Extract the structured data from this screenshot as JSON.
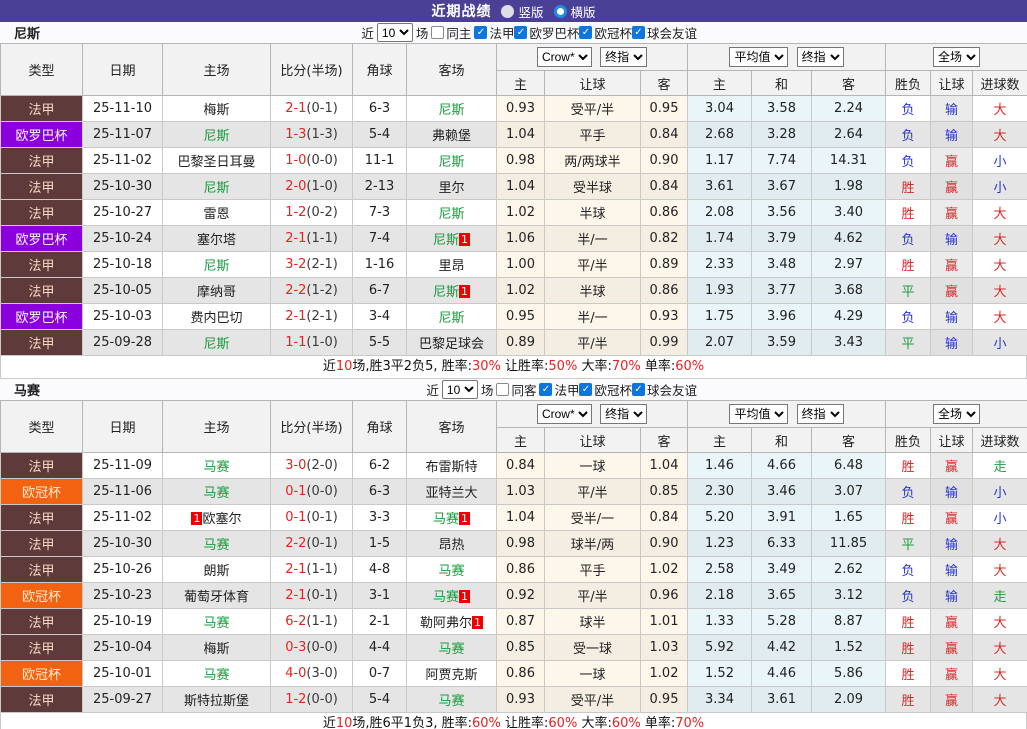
{
  "title_bar": {
    "title": "近期战绩",
    "vertical_label": "竖版",
    "horizontal_label": "横版"
  },
  "league_styles": {
    "法甲": {
      "bg": "#5E3A3A",
      "fg": "#F5DBC4"
    },
    "欧罗巴杯": {
      "bg": "#8A00DD",
      "fg": "#FFFFFF"
    },
    "欧冠杯": {
      "bg": "#F26211",
      "fg": "#FFF0D2"
    }
  },
  "result_colors": {
    "胜": "#D42A2A",
    "负": "#2635CE",
    "平": "#1E9E3E",
    "赢": "#D42A2A",
    "输": "#2635CE",
    "走": "#1E9E3E",
    "大": "#D42A2A",
    "小": "#2635CE"
  },
  "sections": [
    {
      "team": "尼斯",
      "filter": {
        "near_label": "近",
        "games_count": "10",
        "games_label": "场",
        "same_label": "同主",
        "leagues": [
          "法甲",
          "欧罗巴杯",
          "欧冠杯",
          "球会友谊"
        ]
      },
      "header": {
        "cols": [
          "类型",
          "日期",
          "主场",
          "比分(半场)",
          "角球",
          "客场"
        ],
        "dropdowns": [
          "Crow*",
          "终指",
          "平均值",
          "终指",
          "全场"
        ],
        "sub": [
          "主",
          "让球",
          "客",
          "主",
          "和",
          "客",
          "胜负",
          "让球",
          "进球数"
        ]
      },
      "rows": [
        {
          "lg": "法甲",
          "dt": "25-11-10",
          "hm": "梅斯",
          "hf": 0,
          "hc": 0,
          "sc": "2-1",
          "ht": "(0-1)",
          "cn": "6-3",
          "aw": "尼斯",
          "af": 1,
          "ac": 0,
          "o1": "0.93",
          "hd": "受平/半",
          "o2": "0.95",
          "ah": "3.04",
          "ad": "3.58",
          "aa": "2.24",
          "r1": "负",
          "r2": "输",
          "r3": "大"
        },
        {
          "lg": "欧罗巴杯",
          "dt": "25-11-07",
          "hm": "尼斯",
          "hf": 1,
          "hc": 0,
          "sc": "1-3",
          "ht": "(1-3)",
          "cn": "5-4",
          "aw": "弗赖堡",
          "af": 0,
          "ac": 0,
          "o1": "1.04",
          "hd": "平手",
          "o2": "0.84",
          "ah": "2.68",
          "ad": "3.28",
          "aa": "2.64",
          "r1": "负",
          "r2": "输",
          "r3": "大"
        },
        {
          "lg": "法甲",
          "dt": "25-11-02",
          "hm": "巴黎圣日耳曼",
          "hf": 0,
          "hc": 0,
          "sc": "1-0",
          "ht": "(0-0)",
          "cn": "11-1",
          "aw": "尼斯",
          "af": 1,
          "ac": 0,
          "o1": "0.98",
          "hd": "两/两球半",
          "o2": "0.90",
          "ah": "1.17",
          "ad": "7.74",
          "aa": "14.31",
          "r1": "负",
          "r2": "赢",
          "r3": "小"
        },
        {
          "lg": "法甲",
          "dt": "25-10-30",
          "hm": "尼斯",
          "hf": 1,
          "hc": 0,
          "sc": "2-0",
          "ht": "(1-0)",
          "cn": "2-13",
          "aw": "里尔",
          "af": 0,
          "ac": 0,
          "o1": "1.04",
          "hd": "受半球",
          "o2": "0.84",
          "ah": "3.61",
          "ad": "3.67",
          "aa": "1.98",
          "r1": "胜",
          "r2": "赢",
          "r3": "小"
        },
        {
          "lg": "法甲",
          "dt": "25-10-27",
          "hm": "雷恩",
          "hf": 0,
          "hc": 0,
          "sc": "1-2",
          "ht": "(0-2)",
          "cn": "7-3",
          "aw": "尼斯",
          "af": 1,
          "ac": 0,
          "o1": "1.02",
          "hd": "半球",
          "o2": "0.86",
          "ah": "2.08",
          "ad": "3.56",
          "aa": "3.40",
          "r1": "胜",
          "r2": "赢",
          "r3": "大"
        },
        {
          "lg": "欧罗巴杯",
          "dt": "25-10-24",
          "hm": "塞尔塔",
          "hf": 0,
          "hc": 0,
          "sc": "2-1",
          "ht": "(1-1)",
          "cn": "7-4",
          "aw": "尼斯",
          "af": 1,
          "ac": 1,
          "o1": "1.06",
          "hd": "半/一",
          "o2": "0.82",
          "ah": "1.74",
          "ad": "3.79",
          "aa": "4.62",
          "r1": "负",
          "r2": "输",
          "r3": "大"
        },
        {
          "lg": "法甲",
          "dt": "25-10-18",
          "hm": "尼斯",
          "hf": 1,
          "hc": 0,
          "sc": "3-2",
          "ht": "(2-1)",
          "cn": "1-16",
          "aw": "里昂",
          "af": 0,
          "ac": 0,
          "o1": "1.00",
          "hd": "平/半",
          "o2": "0.89",
          "ah": "2.33",
          "ad": "3.48",
          "aa": "2.97",
          "r1": "胜",
          "r2": "赢",
          "r3": "大"
        },
        {
          "lg": "法甲",
          "dt": "25-10-05",
          "hm": "摩纳哥",
          "hf": 0,
          "hc": 0,
          "sc": "2-2",
          "ht": "(1-2)",
          "cn": "6-7",
          "aw": "尼斯",
          "af": 1,
          "ac": 1,
          "o1": "1.02",
          "hd": "半球",
          "o2": "0.86",
          "ah": "1.93",
          "ad": "3.77",
          "aa": "3.68",
          "r1": "平",
          "r2": "赢",
          "r3": "大"
        },
        {
          "lg": "欧罗巴杯",
          "dt": "25-10-03",
          "hm": "费内巴切",
          "hf": 0,
          "hc": 0,
          "sc": "2-1",
          "ht": "(2-1)",
          "cn": "3-4",
          "aw": "尼斯",
          "af": 1,
          "ac": 0,
          "o1": "0.95",
          "hd": "半/一",
          "o2": "0.93",
          "ah": "1.75",
          "ad": "3.96",
          "aa": "4.29",
          "r1": "负",
          "r2": "输",
          "r3": "大"
        },
        {
          "lg": "法甲",
          "dt": "25-09-28",
          "hm": "尼斯",
          "hf": 1,
          "hc": 0,
          "sc": "1-1",
          "ht": "(1-0)",
          "cn": "5-5",
          "aw": "巴黎足球会",
          "af": 0,
          "ac": 0,
          "o1": "0.89",
          "hd": "平/半",
          "o2": "0.99",
          "ah": "2.07",
          "ad": "3.59",
          "aa": "3.43",
          "r1": "平",
          "r2": "输",
          "r3": "小"
        }
      ],
      "summary": [
        [
          "近",
          "k"
        ],
        [
          "10",
          "r"
        ],
        [
          "场,胜3平2负5, 胜率:",
          "k"
        ],
        [
          "30%",
          "r"
        ],
        [
          " 让胜率:",
          "k"
        ],
        [
          "50%",
          "r"
        ],
        [
          " 大率:",
          "k"
        ],
        [
          "70%",
          "r"
        ],
        [
          " 单率:",
          "k"
        ],
        [
          "60%",
          "r"
        ]
      ]
    },
    {
      "team": "马赛",
      "filter": {
        "near_label": "近",
        "games_count": "10",
        "games_label": "场",
        "same_label": "同客",
        "leagues": [
          "法甲",
          "欧冠杯",
          "球会友谊"
        ]
      },
      "header": {
        "cols": [
          "类型",
          "日期",
          "主场",
          "比分(半场)",
          "角球",
          "客场"
        ],
        "dropdowns": [
          "Crow*",
          "终指",
          "平均值",
          "终指",
          "全场"
        ],
        "sub": [
          "主",
          "让球",
          "客",
          "主",
          "和",
          "客",
          "胜负",
          "让球",
          "进球数"
        ]
      },
      "rows": [
        {
          "lg": "法甲",
          "dt": "25-11-09",
          "hm": "马赛",
          "hf": 1,
          "hc": 0,
          "sc": "3-0",
          "ht": "(2-0)",
          "cn": "6-2",
          "aw": "布雷斯特",
          "af": 0,
          "ac": 0,
          "o1": "0.84",
          "hd": "一球",
          "o2": "1.04",
          "ah": "1.46",
          "ad": "4.66",
          "aa": "6.48",
          "r1": "胜",
          "r2": "赢",
          "r3": "走"
        },
        {
          "lg": "欧冠杯",
          "dt": "25-11-06",
          "hm": "马赛",
          "hf": 1,
          "hc": 0,
          "sc": "0-1",
          "ht": "(0-0)",
          "cn": "6-3",
          "aw": "亚特兰大",
          "af": 0,
          "ac": 0,
          "o1": "1.03",
          "hd": "平/半",
          "o2": "0.85",
          "ah": "2.30",
          "ad": "3.46",
          "aa": "3.07",
          "r1": "负",
          "r2": "输",
          "r3": "小"
        },
        {
          "lg": "法甲",
          "dt": "25-11-02",
          "hm": "欧塞尔",
          "hf": 0,
          "hc": 1,
          "sc": "0-1",
          "ht": "(0-1)",
          "cn": "3-3",
          "aw": "马赛",
          "af": 1,
          "ac": 1,
          "o1": "1.04",
          "hd": "受半/一",
          "o2": "0.84",
          "ah": "5.20",
          "ad": "3.91",
          "aa": "1.65",
          "r1": "胜",
          "r2": "赢",
          "r3": "小"
        },
        {
          "lg": "法甲",
          "dt": "25-10-30",
          "hm": "马赛",
          "hf": 1,
          "hc": 0,
          "sc": "2-2",
          "ht": "(0-1)",
          "cn": "1-5",
          "aw": "昂热",
          "af": 0,
          "ac": 0,
          "o1": "0.98",
          "hd": "球半/两",
          "o2": "0.90",
          "ah": "1.23",
          "ad": "6.33",
          "aa": "11.85",
          "r1": "平",
          "r2": "输",
          "r3": "大"
        },
        {
          "lg": "法甲",
          "dt": "25-10-26",
          "hm": "朗斯",
          "hf": 0,
          "hc": 0,
          "sc": "2-1",
          "ht": "(1-1)",
          "cn": "4-8",
          "aw": "马赛",
          "af": 1,
          "ac": 0,
          "o1": "0.86",
          "hd": "平手",
          "o2": "1.02",
          "ah": "2.58",
          "ad": "3.49",
          "aa": "2.62",
          "r1": "负",
          "r2": "输",
          "r3": "大"
        },
        {
          "lg": "欧冠杯",
          "dt": "25-10-23",
          "hm": "葡萄牙体育",
          "hf": 0,
          "hc": 0,
          "sc": "2-1",
          "ht": "(0-1)",
          "cn": "3-1",
          "aw": "马赛",
          "af": 1,
          "ac": 1,
          "o1": "0.92",
          "hd": "平/半",
          "o2": "0.96",
          "ah": "2.18",
          "ad": "3.65",
          "aa": "3.12",
          "r1": "负",
          "r2": "输",
          "r3": "走"
        },
        {
          "lg": "法甲",
          "dt": "25-10-19",
          "hm": "马赛",
          "hf": 1,
          "hc": 0,
          "sc": "6-2",
          "ht": "(1-1)",
          "cn": "2-1",
          "aw": "勒阿弗尔",
          "af": 0,
          "ac": 1,
          "o1": "0.87",
          "hd": "球半",
          "o2": "1.01",
          "ah": "1.33",
          "ad": "5.28",
          "aa": "8.87",
          "r1": "胜",
          "r2": "赢",
          "r3": "大"
        },
        {
          "lg": "法甲",
          "dt": "25-10-04",
          "hm": "梅斯",
          "hf": 0,
          "hc": 0,
          "sc": "0-3",
          "ht": "(0-0)",
          "cn": "4-4",
          "aw": "马赛",
          "af": 1,
          "ac": 0,
          "o1": "0.85",
          "hd": "受一球",
          "o2": "1.03",
          "ah": "5.92",
          "ad": "4.42",
          "aa": "1.52",
          "r1": "胜",
          "r2": "赢",
          "r3": "大"
        },
        {
          "lg": "欧冠杯",
          "dt": "25-10-01",
          "hm": "马赛",
          "hf": 1,
          "hc": 0,
          "sc": "4-0",
          "ht": "(3-0)",
          "cn": "0-7",
          "aw": "阿贾克斯",
          "af": 0,
          "ac": 0,
          "o1": "0.86",
          "hd": "一球",
          "o2": "1.02",
          "ah": "1.52",
          "ad": "4.46",
          "aa": "5.86",
          "r1": "胜",
          "r2": "赢",
          "r3": "大"
        },
        {
          "lg": "法甲",
          "dt": "25-09-27",
          "hm": "斯特拉斯堡",
          "hf": 0,
          "hc": 0,
          "sc": "1-2",
          "ht": "(0-0)",
          "cn": "5-4",
          "aw": "马赛",
          "af": 1,
          "ac": 0,
          "o1": "0.93",
          "hd": "受平/半",
          "o2": "0.95",
          "ah": "3.34",
          "ad": "3.61",
          "aa": "2.09",
          "r1": "胜",
          "r2": "赢",
          "r3": "大"
        }
      ],
      "summary": [
        [
          "近",
          "k"
        ],
        [
          "10",
          "r"
        ],
        [
          "场,胜6平1负3, 胜率:",
          "k"
        ],
        [
          "60%",
          "r"
        ],
        [
          " 让胜率:",
          "k"
        ],
        [
          "60%",
          "r"
        ],
        [
          " 大率:",
          "k"
        ],
        [
          "60%",
          "r"
        ],
        [
          " 单率:",
          "k"
        ],
        [
          "70%",
          "r"
        ]
      ]
    }
  ]
}
